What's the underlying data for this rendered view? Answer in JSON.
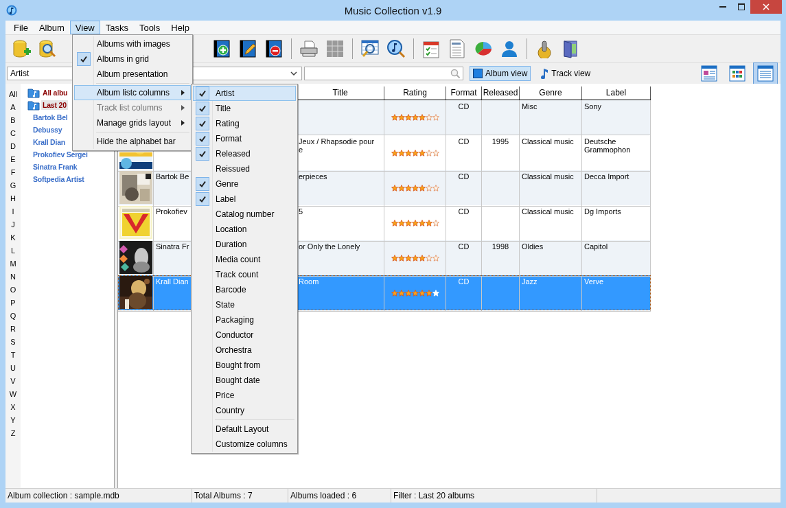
{
  "window": {
    "title": "Music Collection v1.9"
  },
  "menu_bar": [
    {
      "label": "File",
      "selected": false
    },
    {
      "label": "Album",
      "selected": false
    },
    {
      "label": "View",
      "selected": true
    },
    {
      "label": "Tasks",
      "selected": false
    },
    {
      "label": "Tools",
      "selected": false
    },
    {
      "label": "Help",
      "selected": false
    }
  ],
  "filter_bar": {
    "field": "Artist",
    "view_toggles": [
      {
        "label": "Album view",
        "selected": true
      },
      {
        "label": "Track view",
        "selected": false
      }
    ],
    "layout_buttons": [
      {
        "selected": false
      },
      {
        "selected": false
      },
      {
        "selected": true
      }
    ]
  },
  "alphabet_bar": [
    "All",
    "A",
    "B",
    "C",
    "D",
    "E",
    "F",
    "G",
    "H",
    "I",
    "J",
    "K",
    "L",
    "M",
    "N",
    "O",
    "P",
    "Q",
    "R",
    "S",
    "T",
    "U",
    "V",
    "W",
    "X",
    "Y",
    "Z"
  ],
  "tree": {
    "folders": [
      {
        "label": "All albu",
        "selected": false
      },
      {
        "label": "Last 20",
        "selected": true
      }
    ],
    "artists": [
      "Bartok Bel",
      "Debussy",
      "Krall Dian",
      "Prokofiev Sergei",
      "Sinatra Frank",
      "Softpedia Artist"
    ]
  },
  "table": {
    "columns": [
      "Title",
      "Rating",
      "Format",
      "Released",
      "Genre",
      "Label"
    ],
    "rows": [
      {
        "selected": false,
        "stars": 5,
        "format": "CD",
        "genre": "Misc",
        "label": "Sony"
      },
      {
        "selected": false,
        "title": "Jeux / Rhapsodie pour\ne",
        "stars": 5,
        "format": "CD",
        "released": "1995",
        "genre": "Classical music",
        "label": "Deutsche Grammophon"
      },
      {
        "selected": false,
        "artist": "Bartok Be",
        "title": "erpieces",
        "stars": 5,
        "format": "CD",
        "genre": "Classical music",
        "label": "Decca Import"
      },
      {
        "selected": false,
        "artist": "Prokofiev",
        "title": "5",
        "stars": 6,
        "format": "CD",
        "genre": "Classical music",
        "label": "Dg Imports"
      },
      {
        "selected": false,
        "artist": "Sinatra Fr",
        "title": "or Only the Lonely",
        "stars": 5,
        "format": "CD",
        "released": "1998",
        "genre": "Oldies",
        "label": "Capitol"
      },
      {
        "selected": true,
        "artist": "Krall Dian",
        "title": "Room",
        "stars": 6,
        "format": "CD",
        "genre": "Jazz",
        "label": "Verve"
      }
    ]
  },
  "view_menu": [
    {
      "kind": "item",
      "label": "Albums with images",
      "checked": false,
      "selected": false,
      "disabled": false,
      "submenu": false
    },
    {
      "kind": "item",
      "label": "Albums in grid",
      "checked": true,
      "selected": false,
      "disabled": false,
      "submenu": false
    },
    {
      "kind": "item",
      "label": "Album presentation",
      "checked": false,
      "selected": false,
      "disabled": false,
      "submenu": false
    },
    {
      "kind": "separator"
    },
    {
      "kind": "item",
      "label": "Album listc columns",
      "checked": false,
      "selected": true,
      "disabled": false,
      "submenu": true
    },
    {
      "kind": "item",
      "label": "Track list columns",
      "checked": false,
      "selected": false,
      "disabled": true,
      "submenu": true
    },
    {
      "kind": "item",
      "label": "Manage grids layout",
      "checked": false,
      "selected": false,
      "disabled": false,
      "submenu": true
    },
    {
      "kind": "separator"
    },
    {
      "kind": "item",
      "label": "Hide the alphabet bar",
      "checked": false,
      "selected": false,
      "disabled": false,
      "submenu": false
    }
  ],
  "columns_submenu": [
    {
      "kind": "item",
      "label": "Artist",
      "checked": true,
      "selected": true
    },
    {
      "kind": "item",
      "label": "Title",
      "checked": true,
      "selected": false
    },
    {
      "kind": "item",
      "label": "Rating",
      "checked": true,
      "selected": false
    },
    {
      "kind": "item",
      "label": "Format",
      "checked": true,
      "selected": false
    },
    {
      "kind": "item",
      "label": "Released",
      "checked": true,
      "selected": false
    },
    {
      "kind": "item",
      "label": "Reissued",
      "checked": false,
      "selected": false
    },
    {
      "kind": "item",
      "label": "Genre",
      "checked": true,
      "selected": false
    },
    {
      "kind": "item",
      "label": "Label",
      "checked": true,
      "selected": false
    },
    {
      "kind": "item",
      "label": "Catalog number",
      "checked": false,
      "selected": false
    },
    {
      "kind": "item",
      "label": "Location",
      "checked": false,
      "selected": false
    },
    {
      "kind": "item",
      "label": "Duration",
      "checked": false,
      "selected": false
    },
    {
      "kind": "item",
      "label": "Media count",
      "checked": false,
      "selected": false
    },
    {
      "kind": "item",
      "label": "Track count",
      "checked": false,
      "selected": false
    },
    {
      "kind": "item",
      "label": "Barcode",
      "checked": false,
      "selected": false
    },
    {
      "kind": "item",
      "label": "State",
      "checked": false,
      "selected": false
    },
    {
      "kind": "item",
      "label": "Packaging",
      "checked": false,
      "selected": false
    },
    {
      "kind": "item",
      "label": "Conductor",
      "checked": false,
      "selected": false
    },
    {
      "kind": "item",
      "label": "Orchestra",
      "checked": false,
      "selected": false
    },
    {
      "kind": "item",
      "label": "Bought from",
      "checked": false,
      "selected": false
    },
    {
      "kind": "item",
      "label": "Bought date",
      "checked": false,
      "selected": false
    },
    {
      "kind": "item",
      "label": "Price",
      "checked": false,
      "selected": false
    },
    {
      "kind": "item",
      "label": "Country",
      "checked": false,
      "selected": false
    },
    {
      "kind": "separator"
    },
    {
      "kind": "item",
      "label": "Default Layout",
      "checked": false,
      "selected": false
    },
    {
      "kind": "item",
      "label": "Customize columns",
      "checked": false,
      "selected": false
    }
  ],
  "status_bar": [
    "Album collection : sample.mdb",
    "Total Albums : 7",
    "Albums loaded : 6",
    "Filter : Last 20 albums"
  ]
}
